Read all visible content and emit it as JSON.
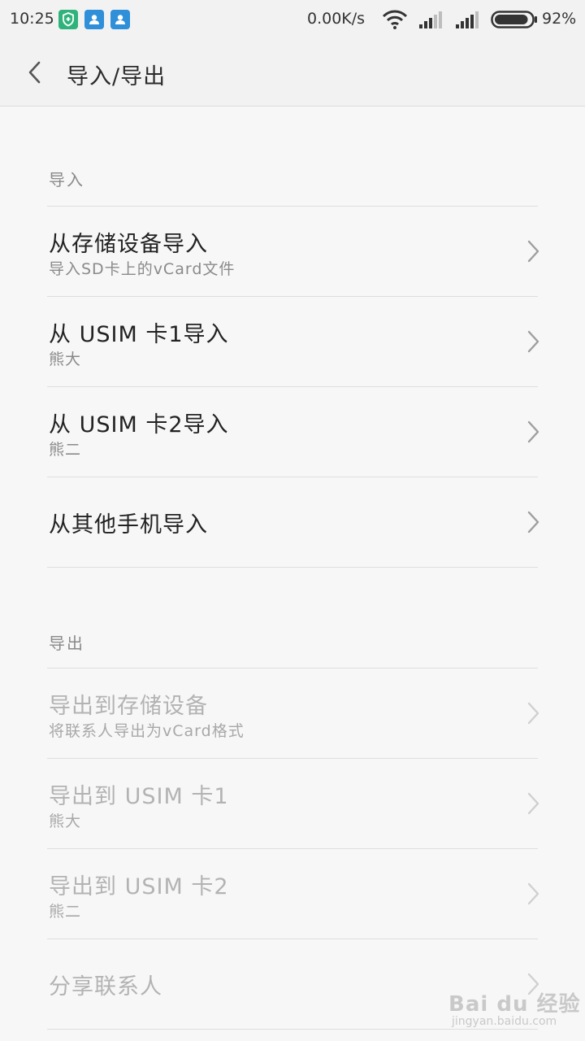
{
  "status_bar": {
    "time": "10:25",
    "net_speed": "0.00K/s",
    "battery_percent": "92%",
    "battery_level": 0.92,
    "icons": [
      "shield-notification-icon",
      "contacts-notification-icon",
      "contacts-notification-icon",
      "wifi-icon",
      "signal-icon",
      "signal-icon",
      "battery-icon"
    ],
    "accent_green": "#2fb37b",
    "accent_blue": "#2f8fd8"
  },
  "header": {
    "title": "导入/导出",
    "back_icon": "chevron-left-icon"
  },
  "import_section": {
    "header": "导入",
    "items": [
      {
        "title": "从存储设备导入",
        "subtitle": "导入SD卡上的vCard文件"
      },
      {
        "title": "从 USIM 卡1导入",
        "subtitle": "熊大"
      },
      {
        "title": "从 USIM 卡2导入",
        "subtitle": "熊二"
      },
      {
        "title": "从其他手机导入",
        "subtitle": ""
      }
    ]
  },
  "export_section": {
    "header": "导出",
    "items": [
      {
        "title": "导出到存储设备",
        "subtitle": "将联系人导出为vCard格式"
      },
      {
        "title": "导出到 USIM 卡1",
        "subtitle": "熊大"
      },
      {
        "title": "导出到 USIM 卡2",
        "subtitle": "熊二"
      },
      {
        "title": "分享联系人",
        "subtitle": ""
      }
    ]
  },
  "watermark": {
    "logo": "Bai du 经验",
    "url": "jingyan.baidu.com"
  }
}
